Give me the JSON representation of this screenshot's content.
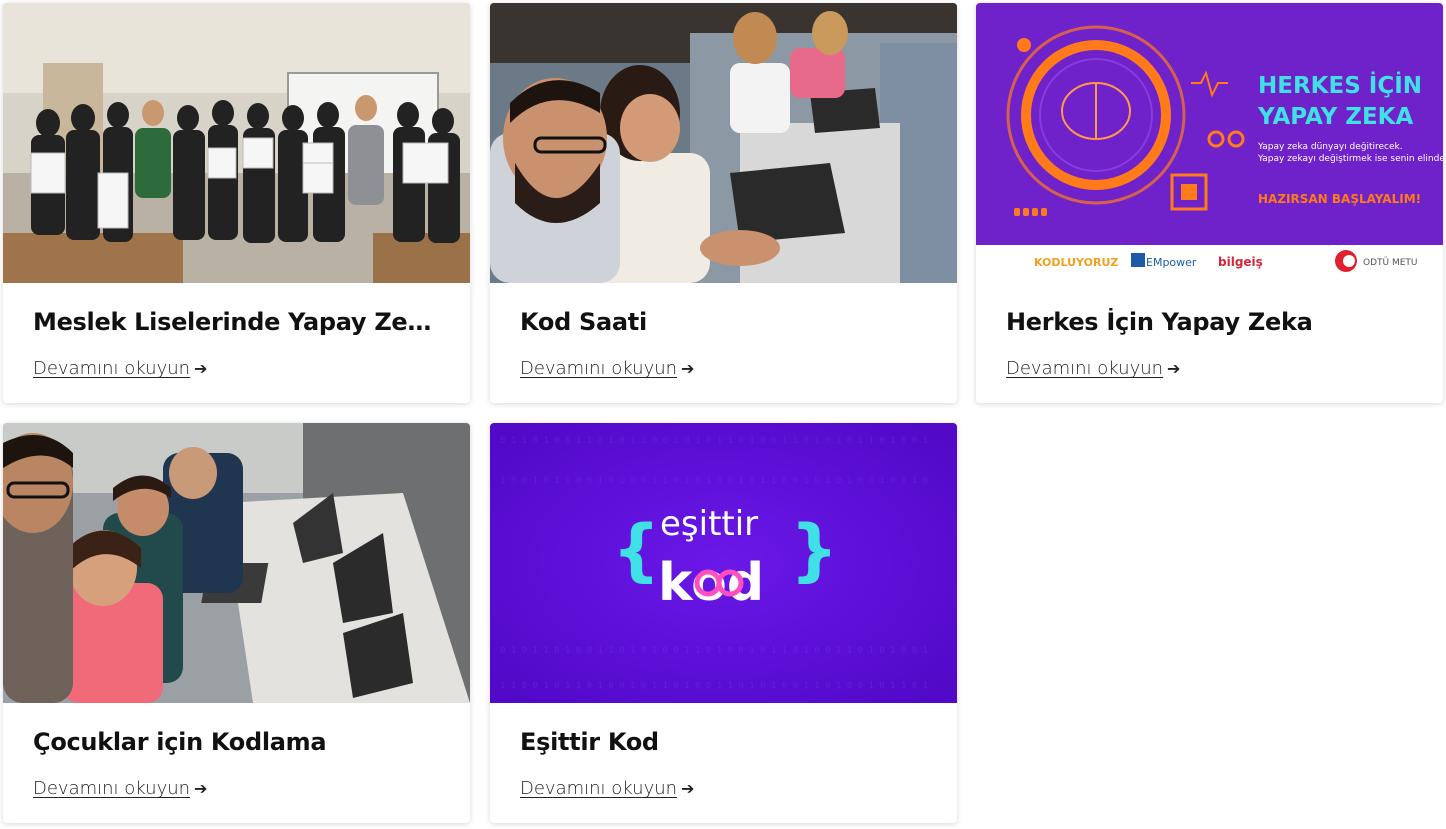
{
  "read_more_label": "Devamını okuyun",
  "read_more_arrow": "➔",
  "cards": [
    {
      "title": "Meslek Liselerinde Yapay Zeka E...",
      "image": "classroom-group-photo"
    },
    {
      "title": "Kod Saati",
      "image": "students-at-laptops-photo"
    },
    {
      "title": "Herkes İçin Yapay Zeka",
      "image": "ai-for-everyone-banner",
      "banner": {
        "heading_line1": "HERKES İÇİN",
        "heading_line2": "YAPAY ZEKA",
        "sub_line1": "Yapay zeka dünyayı değitirecek.",
        "sub_line2": "Yapay zekayı değiştirmek ise senin elinde.",
        "cta": "HAZIRSAN BAŞLAYALIM!",
        "logos": [
          "KODLUYORUZ",
          "EMpower",
          "bilgeiş",
          "ODTÜ METU"
        ]
      }
    },
    {
      "title": "Çocuklar için Kodlama",
      "image": "children-coding-photo"
    },
    {
      "title": "Eşittir Kod",
      "image": "esittir-kod-logo",
      "logo": {
        "word1": "eşittir",
        "word2": "kod"
      }
    }
  ],
  "colors": {
    "banner_purple": "#6f22c9",
    "banner_cyan": "#3fe0e6",
    "banner_orange": "#ff7a1a",
    "esittir_purple": "#5a10d8",
    "esittir_pink": "#ff4fbf"
  }
}
